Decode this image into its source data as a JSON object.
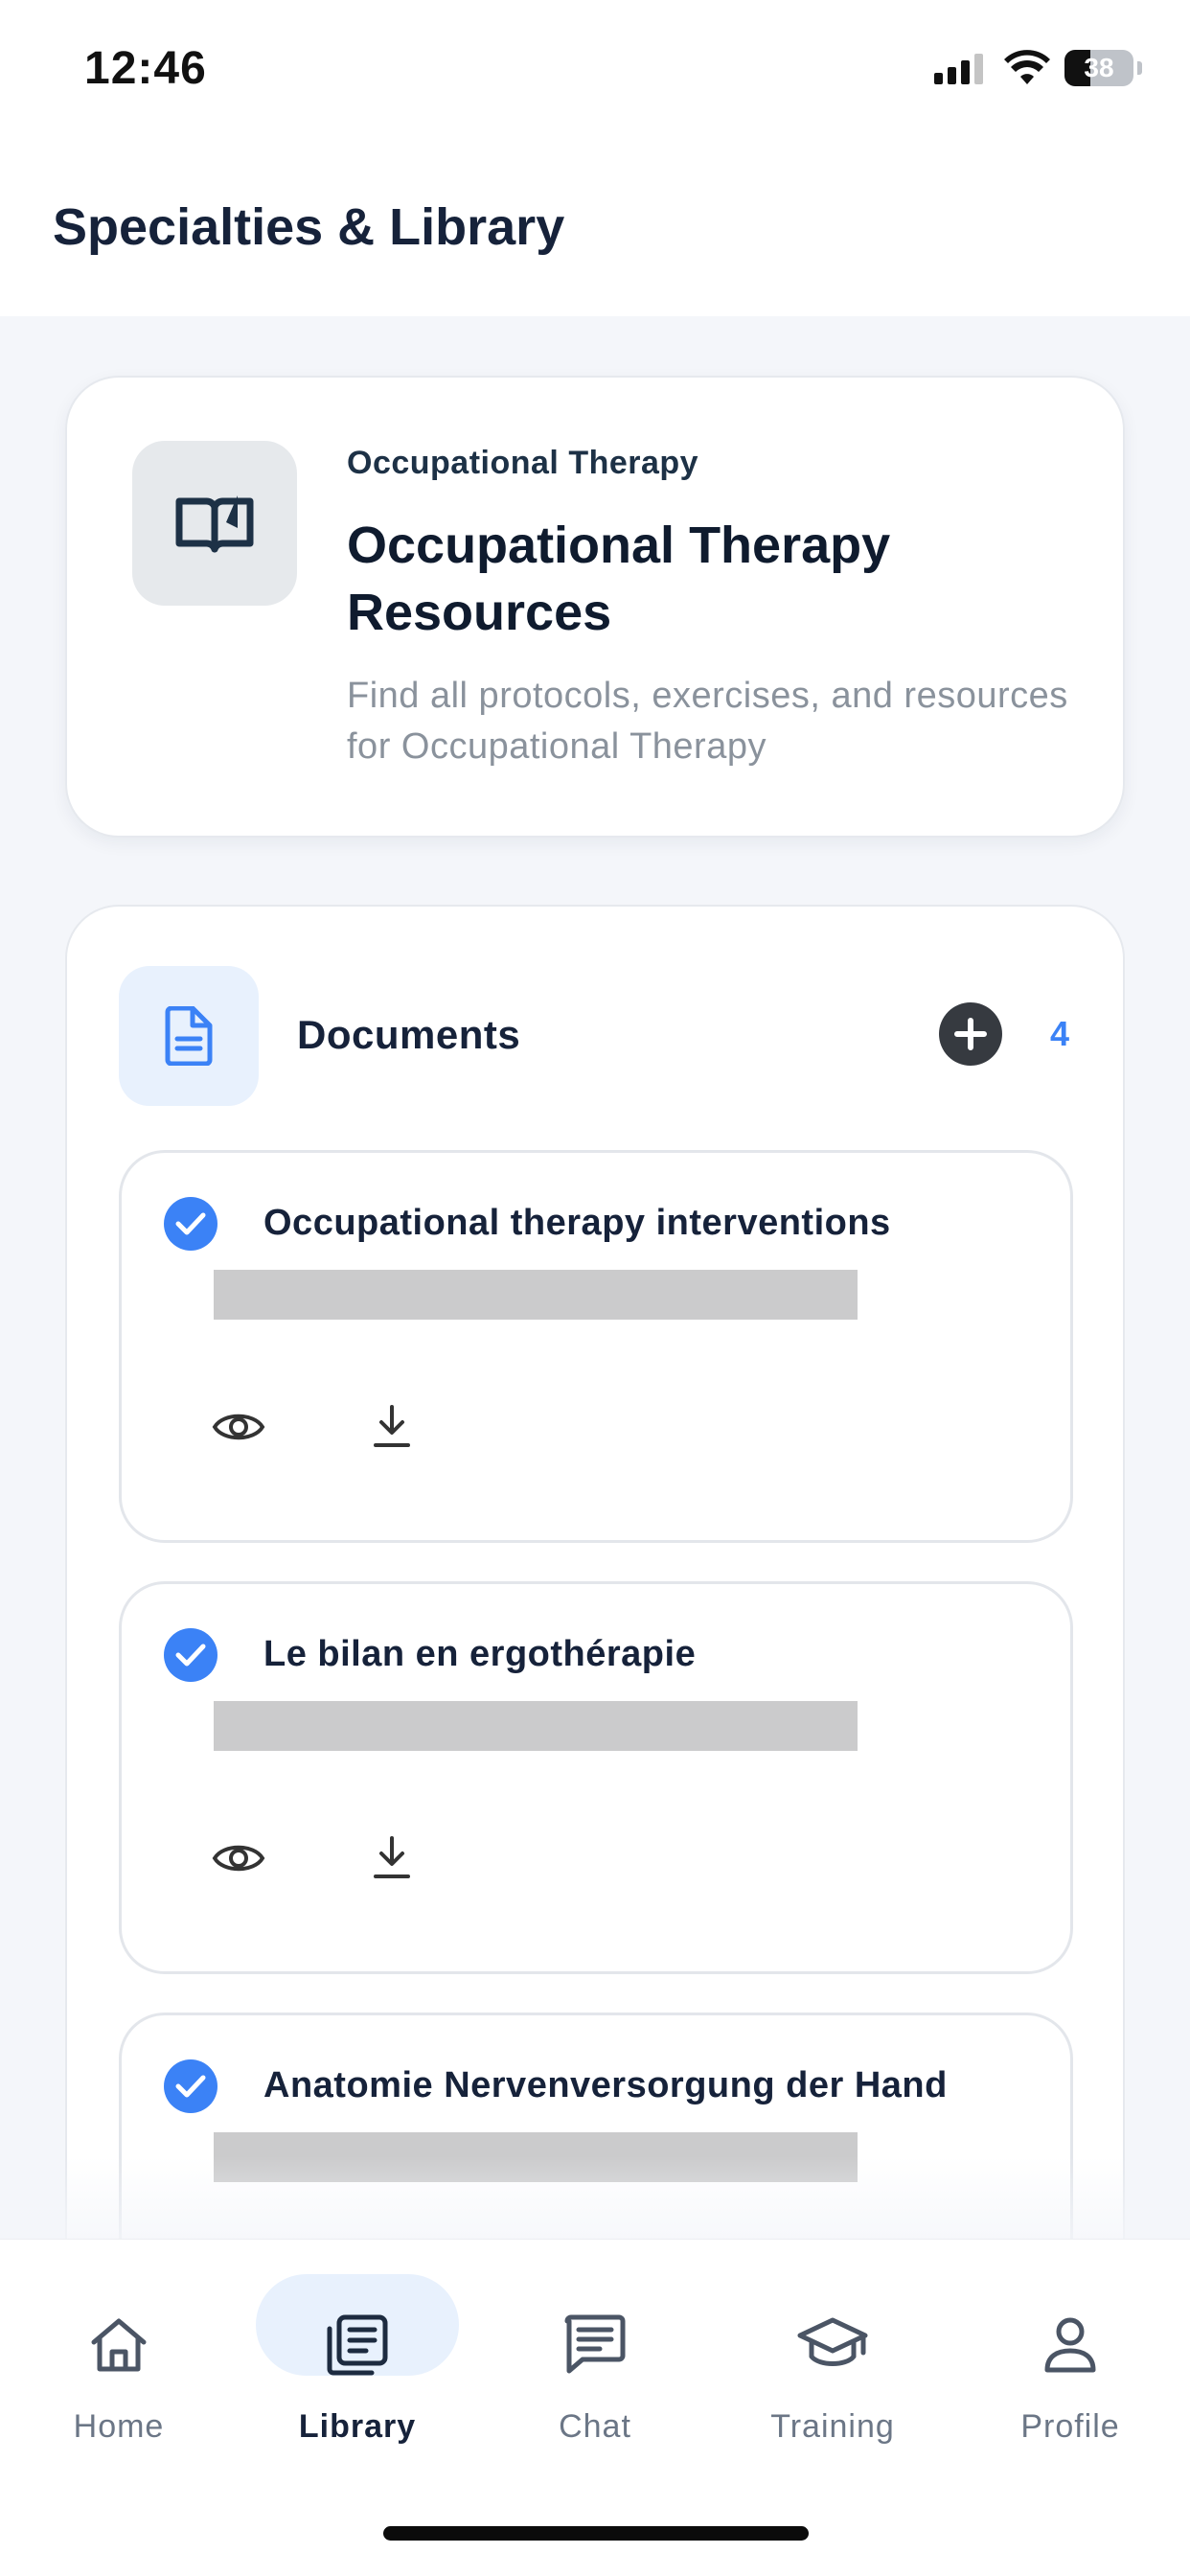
{
  "status_bar": {
    "time": "12:46",
    "battery": "38"
  },
  "header": {
    "title": "Specialties & Library"
  },
  "hero": {
    "eyebrow": "Occupational Therapy",
    "title": "Occupational Therapy Resources",
    "description": "Find all protocols, exercises, and resources for Occupational Therapy",
    "icon": "open-book-icon"
  },
  "documents": {
    "title": "Documents",
    "count": "4",
    "items": [
      {
        "title": "Occupational therapy interventions",
        "checked": true
      },
      {
        "title": "Le bilan en ergothérapie",
        "checked": true
      },
      {
        "title": "Anatomie Nervenversorgung der Hand",
        "checked": true
      }
    ]
  },
  "bottom_nav": {
    "active": "Library",
    "items": [
      {
        "label": "Home",
        "icon": "home-icon"
      },
      {
        "label": "Library",
        "icon": "library-icon"
      },
      {
        "label": "Chat",
        "icon": "chat-icon"
      },
      {
        "label": "Training",
        "icon": "graduation-cap-icon"
      },
      {
        "label": "Profile",
        "icon": "profile-icon"
      }
    ]
  },
  "colors": {
    "accent": "#3b82f6",
    "accent_light": "#e8f1fd",
    "text_dark": "#16223a",
    "muted": "#8a929c"
  }
}
